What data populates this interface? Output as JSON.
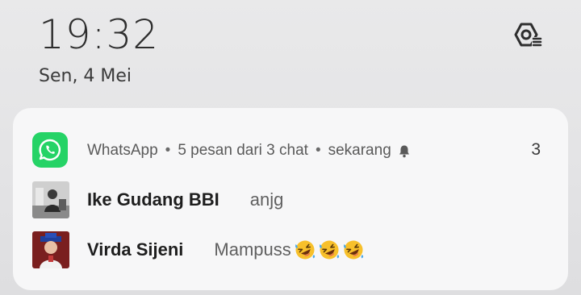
{
  "lockscreen": {
    "time": "19:32",
    "date": "Sen, 4 Mei"
  },
  "icons": {
    "settings": "settings-gear-icon",
    "app": "whatsapp-icon",
    "bell": "bell-icon",
    "emoji": "rofl-emoji-icon"
  },
  "notification": {
    "app_name": "WhatsApp",
    "summary": "5 pesan dari 3 chat",
    "time": "sekarang",
    "count": "3",
    "separator": "•",
    "accent_color": "#25d366",
    "messages": [
      {
        "sender": "Ike Gudang BBI",
        "text": "anjg"
      },
      {
        "sender": "Virda Sijeni",
        "text": "Mampuss"
      }
    ]
  }
}
